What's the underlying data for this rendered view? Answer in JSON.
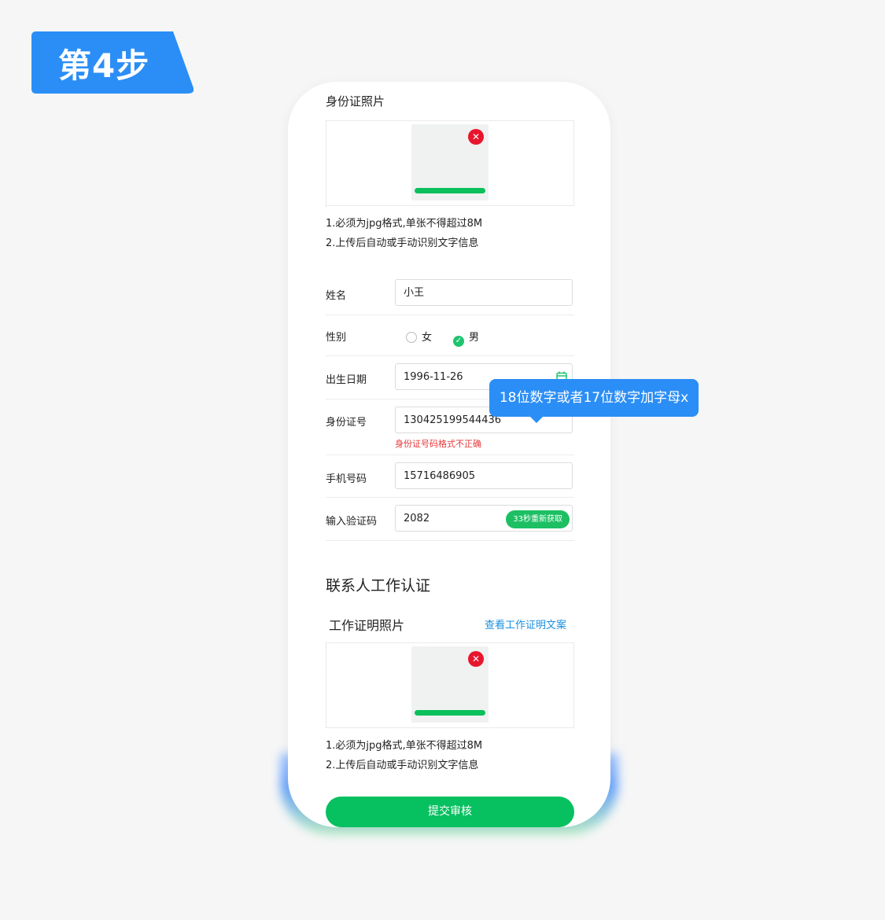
{
  "step_badge": {
    "label": "第4步",
    "color": "#2b8ef6"
  },
  "id_photo": {
    "title": "身份证照片",
    "notes": [
      "1.必须为jpg格式,单张不得超过8M",
      "2.上传后自动或手动识别文字信息"
    ],
    "delete_icon": "close-icon",
    "upload_progress": 1.0
  },
  "form": {
    "name": {
      "label": "姓名",
      "value": "小王"
    },
    "gender": {
      "label": "性别",
      "options": [
        "女",
        "男"
      ],
      "selected": "男"
    },
    "birthdate": {
      "label": "出生日期",
      "value": "1996-11-26",
      "icon": "calendar-icon"
    },
    "id_number": {
      "label": "身份证号",
      "value": "130425199544436",
      "error": "身份证号码格式不正确"
    },
    "phone": {
      "label": "手机号码",
      "value": "15716486905"
    },
    "verify_code": {
      "label": "输入验证码",
      "value": "2082",
      "button": "33秒重新获取"
    }
  },
  "work_section": {
    "title": "联系人工作认证",
    "photo_title": "工作证明照片",
    "link": "查看工作证明文案",
    "notes": [
      "1.必须为jpg格式,单张不得超过8M",
      "2.上传后自动或手动识别文字信息"
    ],
    "delete_icon": "close-icon",
    "upload_progress": 1.0
  },
  "submit_label": "提交审核",
  "tooltip": "18位数字或者17位数字加字母x",
  "colors": {
    "primary_green": "#07c060",
    "error_red": "#e5393a",
    "link_blue": "#1a8fe0",
    "tooltip_blue": "#2b8ef6"
  }
}
